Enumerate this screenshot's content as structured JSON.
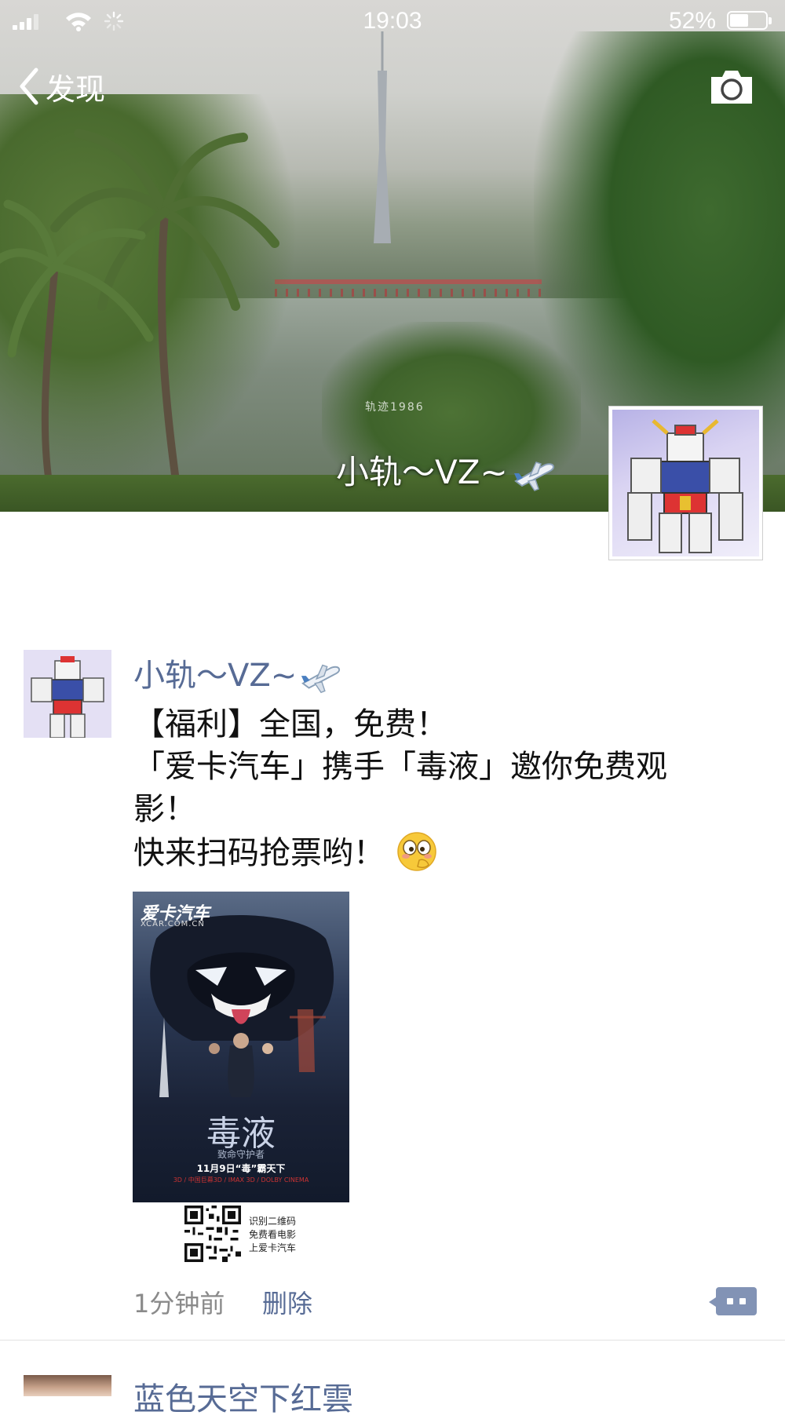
{
  "status_bar": {
    "time": "19:03",
    "battery_percent": "52%",
    "battery_level": 0.52
  },
  "nav": {
    "back_label": "发现"
  },
  "cover": {
    "user_name": "小轨～VZ~",
    "watermark": "轨迹1986"
  },
  "post": {
    "author": "小轨～VZ~",
    "text_lines": [
      "【福利】全国，免费！",
      "「爱卡汽车」携手「毒液」邀你免费观",
      "影！",
      "快来扫码抢票哟！"
    ],
    "poster": {
      "brand": "爱卡汽车",
      "brand_sub": "XCAR.COM.CN",
      "title": "毒液",
      "subtitle": "致命守护者",
      "date": "11月9日“毒”霸天下",
      "formats": "3D / 中国巨幕3D / IMAX 3D / DOLBY CINEMA"
    },
    "qr_caption": [
      "识别二维码",
      "免费看电影",
      "上爱卡汽车"
    ],
    "time": "1分钟前",
    "delete_label": "删除"
  },
  "next_post": {
    "author": "蓝色天空下红雲"
  },
  "colors": {
    "link_blue": "#576b95",
    "comment_button": "#8293b5",
    "secondary_text": "#8a8a8a"
  }
}
